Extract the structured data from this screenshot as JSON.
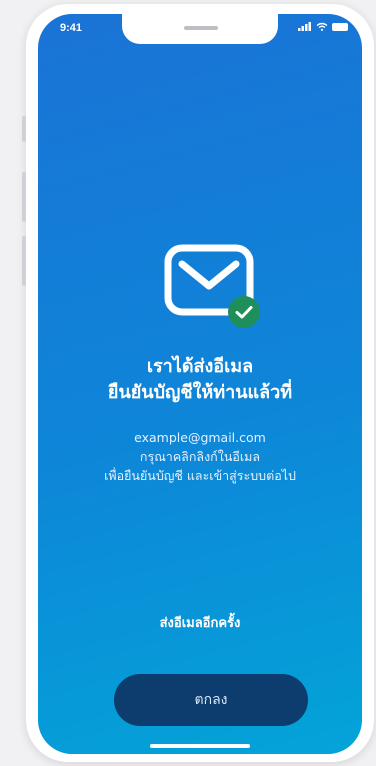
{
  "status_bar": {
    "time": "9:41"
  },
  "confirmation": {
    "title_line1": "เราได้ส่งอีเมล",
    "title_line2": "ยืนยันบัญชีให้ท่านแล้วที่",
    "email": "example@gmail.com",
    "instruction_line1": "กรุณาคลิกลิงก์ในอีเมล",
    "instruction_line2": "เพื่อยืนยันบัญชี และเข้าสู่ระบบต่อไป"
  },
  "actions": {
    "resend_label": "ส่งอีเมลอีกครั้ง",
    "ok_label": "ตกลง"
  },
  "icons": {
    "mail": "mail-icon",
    "check": "check-badge-icon"
  },
  "colors": {
    "gradient_start": "#1a73d6",
    "gradient_end": "#03a4d8",
    "button_bg": "#0c3d6e",
    "check_badge": "#1e8e5a"
  }
}
